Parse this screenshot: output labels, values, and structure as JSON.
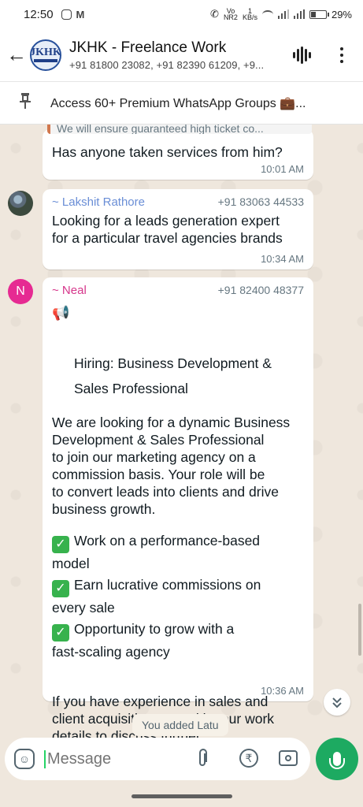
{
  "status_bar": {
    "time": "12:50",
    "volte_top": "Vo",
    "volte_bottom": "NR2",
    "speed_top": "1",
    "speed_bottom": "KB/s",
    "battery": "29%",
    "battery_level": 0.29
  },
  "header": {
    "avatar_text": "JKHK",
    "title": "JKHK - Freelance Work",
    "subtitle": "+91 81800 23082, +91 82390 61209, +9..."
  },
  "pinned": {
    "text": "Access 60+ Premium WhatsApp Groups 💼..."
  },
  "messages": [
    {
      "quote": "We will ensure guaranteed high ticket co...",
      "text": "Has anyone taken services from him?",
      "time": "10:01 AM"
    },
    {
      "sender": "~ Lakshit Rathore",
      "phone": "+91 83063 44533",
      "text": "Looking for a leads generation expert\nfor a particular travel agencies brands",
      "time": "10:34 AM"
    },
    {
      "avatar_letter": "N",
      "sender": "~ Neal",
      "phone": "+91 82400 48377",
      "heading": "Hiring: Business Development &\nSales Professional",
      "intro": "We are looking for a dynamic Business\nDevelopment & Sales Professional\nto join our marketing agency on a\ncommission basis. Your role will be\nto convert leads into clients and drive\nbusiness growth.",
      "points": [
        "Work on a performance-based\nmodel",
        "Earn lucrative commissions on\nevery sale",
        "Opportunity to grow with a\nfast-scaling agency"
      ],
      "closing": "If you have experience in sales and\nclient acquisition, DM with your work\ndetails to discuss further.",
      "time": "10:36 AM"
    }
  ],
  "system_message": "You added Latu",
  "composer": {
    "placeholder": "Message"
  }
}
